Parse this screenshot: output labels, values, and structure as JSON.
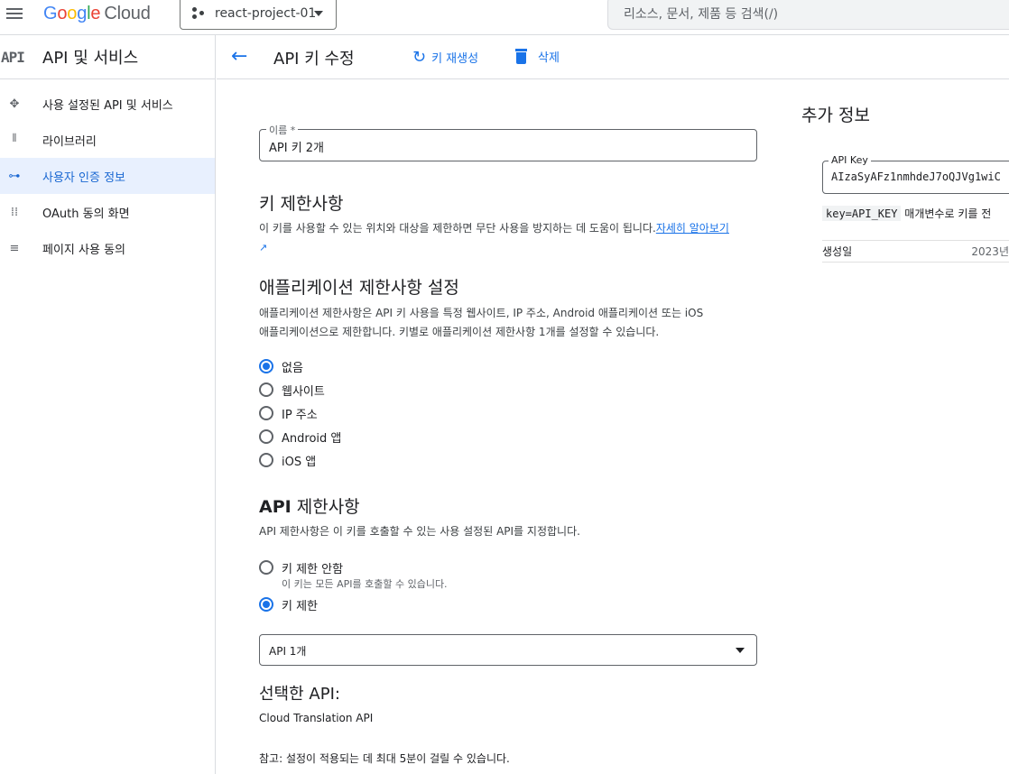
{
  "topbar": {
    "logo_letters": [
      "G",
      "o",
      "o",
      "g",
      "l",
      "e"
    ],
    "logo_suffix": "Cloud",
    "project_name": "react-project-01",
    "search_placeholder": "리소스, 문서, 제품 등 검색(/)"
  },
  "sidebar": {
    "header_logo": "API",
    "title": "API 및 서비스",
    "items": [
      {
        "label": "사용 설정된 API 및 서비스",
        "icon": "diamond-arrows-icon"
      },
      {
        "label": "라이브러리",
        "icon": "library-icon"
      },
      {
        "label": "사용자 인증 정보",
        "icon": "key-icon",
        "active": true
      },
      {
        "label": "OAuth 동의 화면",
        "icon": "consent-dots-icon"
      },
      {
        "label": "페이지 사용 동의",
        "icon": "settings-list-icon"
      }
    ]
  },
  "actionbar": {
    "title": "API 키 수정",
    "regenerate_label": "키 재생성",
    "delete_label": "삭제"
  },
  "form": {
    "name_label": "이름 *",
    "name_value": "API 키 2개",
    "key_restrictions_title": "키 제한사항",
    "key_restrictions_desc": "이 키를 사용할 수 있는 위치와 대상을 제한하면 무단 사용을 방지하는 데 도움이 됩니다.",
    "learn_more": "자세히 알아보기",
    "app_restrictions_title": "애플리케이션 제한사항 설정",
    "app_restrictions_desc_1": "애플리케이션 제한사항은 API 키 사용을 특정 웹사이트, IP 주소, Android 애플리케이션 또는 iOS",
    "app_restrictions_desc_2": "애플리케이션으로 제한합니다. 키별로 애플리케이션 제한사항 1개를 설정할 수 있습니다.",
    "app_options": [
      {
        "label": "없음",
        "selected": true
      },
      {
        "label": "웹사이트",
        "selected": false
      },
      {
        "label": "IP 주소",
        "selected": false
      },
      {
        "label": "Android 앱",
        "selected": false
      },
      {
        "label": "iOS 앱",
        "selected": false
      }
    ],
    "api_restrictions_title_bold": "API",
    "api_restrictions_title_rest": " 제한사항",
    "api_restrictions_desc": "API 제한사항은 이 키를 호출할 수 있는 사용 설정된 API를 지정합니다.",
    "api_options": [
      {
        "label": "키 제한 안함",
        "selected": false,
        "hint": "이 키는 모든 API를 호출할 수 있습니다."
      },
      {
        "label": "키 제한",
        "selected": true
      }
    ],
    "api_select_value": "API 1개",
    "selected_api_title": "선택한 API:",
    "selected_api_name": "Cloud Translation API",
    "note": "참고: 설정이 적용되는 데 최대 5분이 걸릴 수 있습니다."
  },
  "side_panel": {
    "title": "추가 정보",
    "api_key_label": "API Key",
    "api_key_value": "AIzaSyAFz1nmhdeJ7oQJVg1wiC",
    "param_code": "key=API_KEY",
    "param_text": " 매개변수로 키를 전",
    "created_label": "생성일",
    "created_value": "2023년"
  },
  "colors": {
    "accent": "#1a73e8",
    "active_bg": "#e8f0fe",
    "border": "#dadce0"
  }
}
